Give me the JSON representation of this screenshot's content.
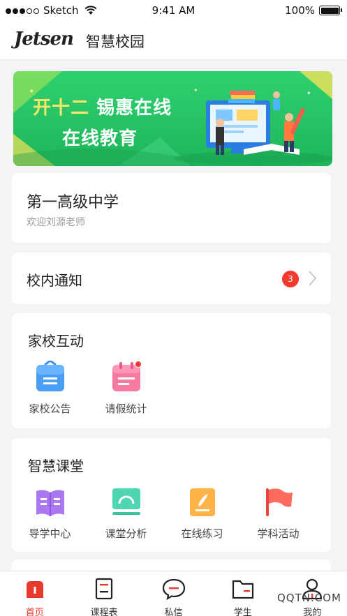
{
  "status_bar": {
    "carrier": "Sketch",
    "time": "9:41 AM",
    "battery": "100%"
  },
  "header": {
    "logo_text": "Jetsen",
    "title": "智慧校园"
  },
  "banner": {
    "line1_yellow": "开十二",
    "line1_white": "锡惠在线",
    "line2": "在线教育"
  },
  "school_card": {
    "name": "第一高级中学",
    "welcome": "欢迎刘源老师"
  },
  "notice": {
    "title": "校内通知",
    "badge_count": "3"
  },
  "home_school": {
    "title": "家校互动",
    "items": [
      {
        "label": "家校公告",
        "icon": "announcement-icon"
      },
      {
        "label": "请假统计",
        "icon": "calendar-icon"
      }
    ]
  },
  "smart_class": {
    "title": "智慧课堂",
    "items": [
      {
        "label": "导学中心",
        "icon": "book-icon"
      },
      {
        "label": "课堂分析",
        "icon": "monitor-icon"
      },
      {
        "label": "在线练习",
        "icon": "practice-icon"
      },
      {
        "label": "学科活动",
        "icon": "flag-icon"
      }
    ]
  },
  "tabbar": {
    "items": [
      {
        "label": "首页",
        "icon": "home-icon"
      },
      {
        "label": "课程表",
        "icon": "schedule-icon"
      },
      {
        "label": "私信",
        "icon": "message-icon"
      },
      {
        "label": "学生",
        "icon": "folder-icon"
      },
      {
        "label": "我的",
        "icon": "profile-icon"
      }
    ]
  },
  "watermark": "QQTN.COM",
  "colors": {
    "accent_red": "#e63a2e",
    "banner_green": "#22c062"
  }
}
